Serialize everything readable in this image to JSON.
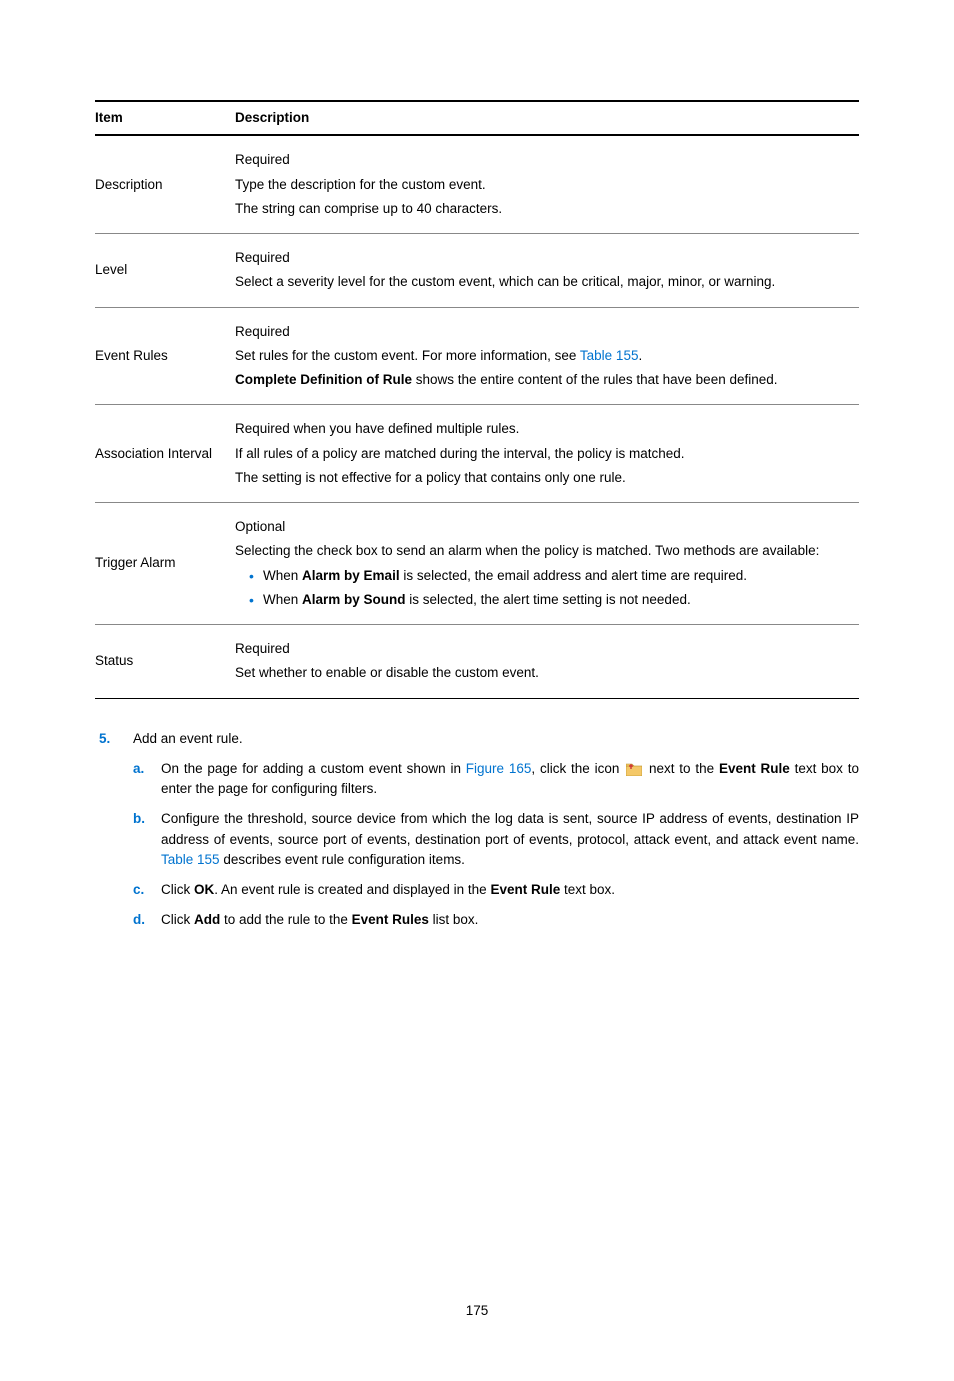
{
  "table": {
    "headers": {
      "item": "Item",
      "description": "Description"
    },
    "rows": [
      {
        "item": "Description",
        "desc": [
          {
            "type": "p",
            "text": "Required"
          },
          {
            "type": "p",
            "text": "Type the description for the custom event."
          },
          {
            "type": "p",
            "text": "The string can comprise up to 40 characters."
          }
        ]
      },
      {
        "item": "Level",
        "desc": [
          {
            "type": "p",
            "text": "Required"
          },
          {
            "type": "p",
            "text": "Select a severity level for the custom event, which can be critical, major, minor, or warning."
          }
        ]
      },
      {
        "item": "Event Rules",
        "desc": [
          {
            "type": "p",
            "text": "Required"
          },
          {
            "type": "p",
            "segments": [
              {
                "text": "Set rules for the custom event. For more information, see "
              },
              {
                "text": "Table 155",
                "link": true
              },
              {
                "text": "."
              }
            ]
          },
          {
            "type": "p",
            "segments": [
              {
                "text": "Complete Definition of Rule",
                "bold": true
              },
              {
                "text": " shows the entire content of the rules that have been defined."
              }
            ]
          }
        ]
      },
      {
        "item": "Association Interval",
        "desc": [
          {
            "type": "p",
            "text": "Required when you have defined multiple rules."
          },
          {
            "type": "p",
            "text": "If all rules of a policy are matched during the interval, the policy is matched."
          },
          {
            "type": "p",
            "text": "The setting is not effective for a policy that contains only one rule."
          }
        ]
      },
      {
        "item": "Trigger Alarm",
        "desc": [
          {
            "type": "p",
            "text": "Optional"
          },
          {
            "type": "p",
            "text": "Selecting the check box to send an alarm when the policy is matched. Two methods are available:"
          },
          {
            "type": "ul",
            "items": [
              {
                "segments": [
                  {
                    "text": "When "
                  },
                  {
                    "text": "Alarm by Email",
                    "bold": true
                  },
                  {
                    "text": " is selected, the email address and alert time are required."
                  }
                ]
              },
              {
                "segments": [
                  {
                    "text": "When "
                  },
                  {
                    "text": "Alarm by Sound",
                    "bold": true
                  },
                  {
                    "text": " is selected, the alert time setting is not needed."
                  }
                ]
              }
            ]
          }
        ]
      },
      {
        "item": "Status",
        "desc": [
          {
            "type": "p",
            "text": "Required"
          },
          {
            "type": "p",
            "text": "Set whether to enable or disable the custom event."
          }
        ]
      }
    ]
  },
  "steps": {
    "main_num": "5.",
    "main_text": "Add an event rule.",
    "subs": [
      {
        "letter": "a.",
        "segments": [
          {
            "text": "On the page for adding a custom event shown in "
          },
          {
            "text": "Figure 165",
            "link": true
          },
          {
            "text": ", click the icon "
          },
          {
            "icon": true
          },
          {
            "text": " next to the "
          },
          {
            "text": "Event Rule",
            "bold": true
          },
          {
            "text": " text box to enter the page for configuring filters."
          }
        ]
      },
      {
        "letter": "b.",
        "segments": [
          {
            "text": "Configure the threshold, source device from which the log data is sent, source IP address of events, destination IP address of events, source port of events, destination port of events, protocol, attack event, and attack event name. "
          },
          {
            "text": "Table 155",
            "link": true
          },
          {
            "text": " describes event rule configuration items."
          }
        ]
      },
      {
        "letter": "c.",
        "segments": [
          {
            "text": "Click "
          },
          {
            "text": "OK",
            "bold": true
          },
          {
            "text": ". An event rule is created and displayed in the "
          },
          {
            "text": "Event Rule",
            "bold": true
          },
          {
            "text": " text box."
          }
        ]
      },
      {
        "letter": "d.",
        "segments": [
          {
            "text": "Click "
          },
          {
            "text": "Add",
            "bold": true
          },
          {
            "text": " to add the rule to the "
          },
          {
            "text": "Event Rules",
            "bold": true
          },
          {
            "text": " list box."
          }
        ]
      }
    ]
  },
  "page_number": "175"
}
